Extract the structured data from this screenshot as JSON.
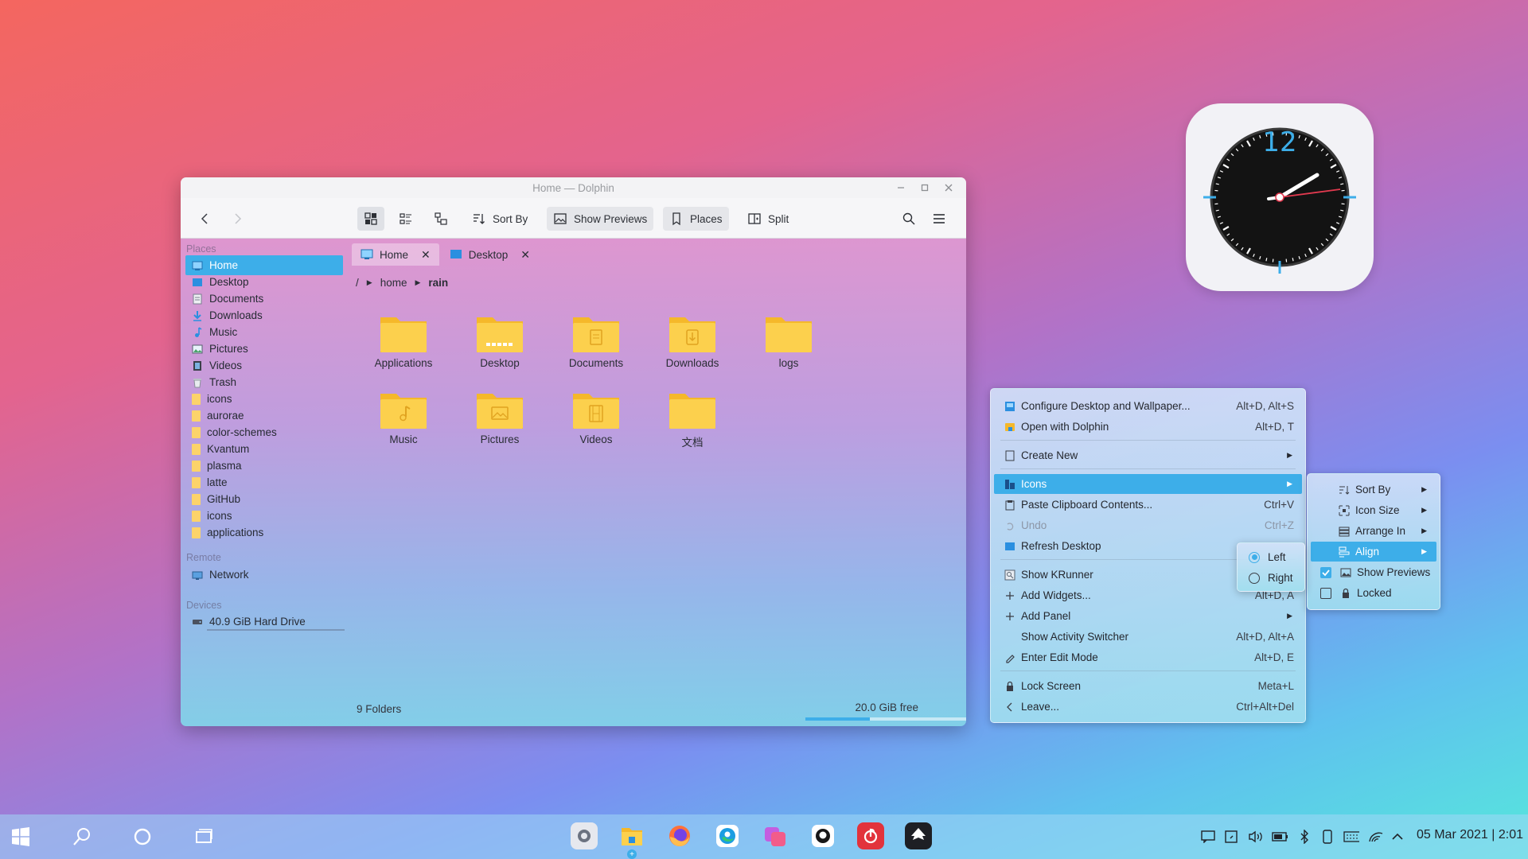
{
  "window": {
    "title": "Home — Dolphin",
    "toolbar": {
      "sort_by": "Sort By",
      "show_previews": "Show Previews",
      "places": "Places",
      "split": "Split"
    },
    "sidebar": {
      "places_header": "Places",
      "places": [
        {
          "label": "Home",
          "icon": "home-icon"
        },
        {
          "label": "Desktop",
          "icon": "desktop-icon"
        },
        {
          "label": "Documents",
          "icon": "documents-icon"
        },
        {
          "label": "Downloads",
          "icon": "downloads-icon"
        },
        {
          "label": "Music",
          "icon": "music-icon"
        },
        {
          "label": "Pictures",
          "icon": "pictures-icon"
        },
        {
          "label": "Videos",
          "icon": "videos-icon"
        },
        {
          "label": "Trash",
          "icon": "trash-icon"
        },
        {
          "label": "icons",
          "icon": "folder-icon"
        },
        {
          "label": "aurorae",
          "icon": "folder-icon"
        },
        {
          "label": "color-schemes",
          "icon": "folder-icon"
        },
        {
          "label": "Kvantum",
          "icon": "folder-icon"
        },
        {
          "label": "plasma",
          "icon": "folder-icon"
        },
        {
          "label": "latte",
          "icon": "folder-icon"
        },
        {
          "label": "GitHub",
          "icon": "folder-icon"
        },
        {
          "label": "icons",
          "icon": "folder-icon"
        },
        {
          "label": "applications",
          "icon": "folder-icon"
        }
      ],
      "remote_header": "Remote",
      "network": "Network",
      "devices_header": "Devices",
      "drive": "40.9 GiB Hard Drive"
    },
    "tabs": [
      {
        "label": "Home"
      },
      {
        "label": "Desktop"
      }
    ],
    "breadcrumb": {
      "root": "/",
      "home": "home",
      "current": "rain"
    },
    "folders": [
      {
        "label": "Applications",
        "emblem": "none"
      },
      {
        "label": "Desktop",
        "emblem": "desktop"
      },
      {
        "label": "Documents",
        "emblem": "document"
      },
      {
        "label": "Downloads",
        "emblem": "download"
      },
      {
        "label": "logs",
        "emblem": "none"
      },
      {
        "label": "Music",
        "emblem": "music"
      },
      {
        "label": "Pictures",
        "emblem": "picture"
      },
      {
        "label": "Videos",
        "emblem": "video"
      },
      {
        "label": "文档",
        "emblem": "none"
      }
    ],
    "status": {
      "count": "9 Folders",
      "free": "20.0 GiB free",
      "used_fraction": 0.4
    }
  },
  "clock_widget": {
    "numeral_12": "12"
  },
  "context_menu": {
    "items": [
      {
        "label": "Configure Desktop and Wallpaper...",
        "shortcut": "Alt+D, Alt+S"
      },
      {
        "label": "Open with Dolphin",
        "shortcut": "Alt+D, T"
      },
      {
        "label": "Create New",
        "shortcut": ""
      },
      {
        "label": "Icons",
        "shortcut": ""
      },
      {
        "label": "Paste Clipboard Contents...",
        "shortcut": "Ctrl+V"
      },
      {
        "label": "Undo",
        "shortcut": "Ctrl+Z"
      },
      {
        "label": "Refresh Desktop",
        "shortcut": ""
      },
      {
        "label": "Show KRunner",
        "shortcut": ""
      },
      {
        "label": "Add Widgets...",
        "shortcut": "Alt+D, A"
      },
      {
        "label": "Add Panel",
        "shortcut": ""
      },
      {
        "label": "Show Activity Switcher",
        "shortcut": "Alt+D, Alt+A"
      },
      {
        "label": "Enter Edit Mode",
        "shortcut": "Alt+D, E"
      },
      {
        "label": "Lock Screen",
        "shortcut": "Meta+L"
      },
      {
        "label": "Leave...",
        "shortcut": "Ctrl+Alt+Del"
      }
    ]
  },
  "icons_submenu": {
    "items": [
      {
        "label": "Sort By"
      },
      {
        "label": "Icon Size"
      },
      {
        "label": "Arrange In"
      },
      {
        "label": "Align"
      },
      {
        "label": "Show Previews",
        "checked": true
      },
      {
        "label": "Locked",
        "checked": false
      }
    ]
  },
  "align_submenu": {
    "items": [
      {
        "label": "Left",
        "selected": true
      },
      {
        "label": "Right",
        "selected": false
      }
    ]
  },
  "taskbar": {
    "datetime": "05 Mar 2021 | 2:01"
  },
  "colors": {
    "accent": "#3daee9",
    "folder": "#fcc53a"
  }
}
